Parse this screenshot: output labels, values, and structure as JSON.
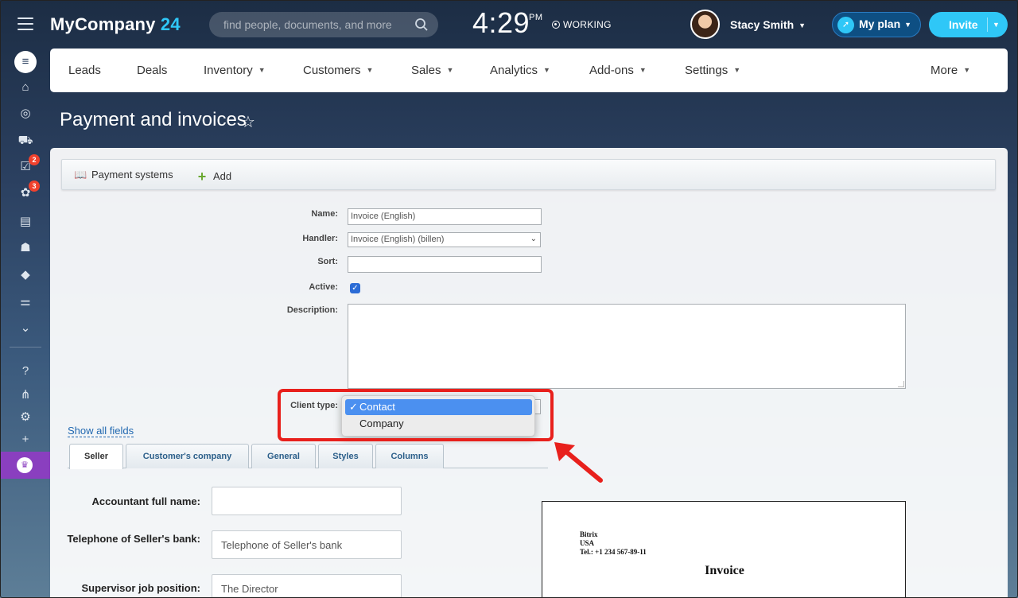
{
  "app": {
    "logo_text": "MyCompany",
    "logo_num": "24",
    "search_placeholder": "find people, documents, and more",
    "clock_time": "4:29",
    "clock_ampm": "PM",
    "work_status": "WORKING",
    "user_name": "Stacy Smith",
    "my_plan": "My plan",
    "invite": "Invite"
  },
  "rail": {
    "badge_tasks": "2",
    "badge_feed": "3"
  },
  "nav": {
    "items": [
      "Leads",
      "Deals",
      "Inventory",
      "Customers",
      "Sales",
      "Analytics",
      "Add-ons",
      "Settings",
      "More"
    ]
  },
  "page": {
    "title": "Payment and invoices"
  },
  "toolbar": {
    "payment_systems": "Payment systems",
    "add": "Add"
  },
  "form": {
    "name_label": "Name:",
    "name_value": "Invoice (English)",
    "handler_label": "Handler:",
    "handler_value": "Invoice (English) (billen)",
    "sort_label": "Sort:",
    "sort_value": "",
    "active_label": "Active:",
    "active_checked": true,
    "description_label": "Description:",
    "client_type_label": "Client type:",
    "client_type_options": [
      "Contact",
      "Company"
    ],
    "client_type_selected": "Contact",
    "check_mark": "✓"
  },
  "show_all_fields": "Show all fields",
  "tabs": [
    "Seller",
    "Customer's company",
    "General",
    "Styles",
    "Columns"
  ],
  "seller_fields": {
    "accountant_label": "Accountant full name:",
    "accountant_value": "",
    "bank_phone_label": "Telephone of Seller's bank:",
    "bank_phone_placeholder": "Telephone of Seller's bank",
    "supervisor_label": "Supervisor job position:",
    "supervisor_value": "The Director"
  },
  "preview": {
    "company": "Bitrix",
    "country": "USA",
    "phone": "Tel.: +1 234 567-89-11",
    "title": "Invoice"
  },
  "colors": {
    "accent": "#2fc7f7",
    "highlight_box": "#e8201c",
    "selected_option": "#4b90f0",
    "plan_button": "#0e4f83"
  }
}
